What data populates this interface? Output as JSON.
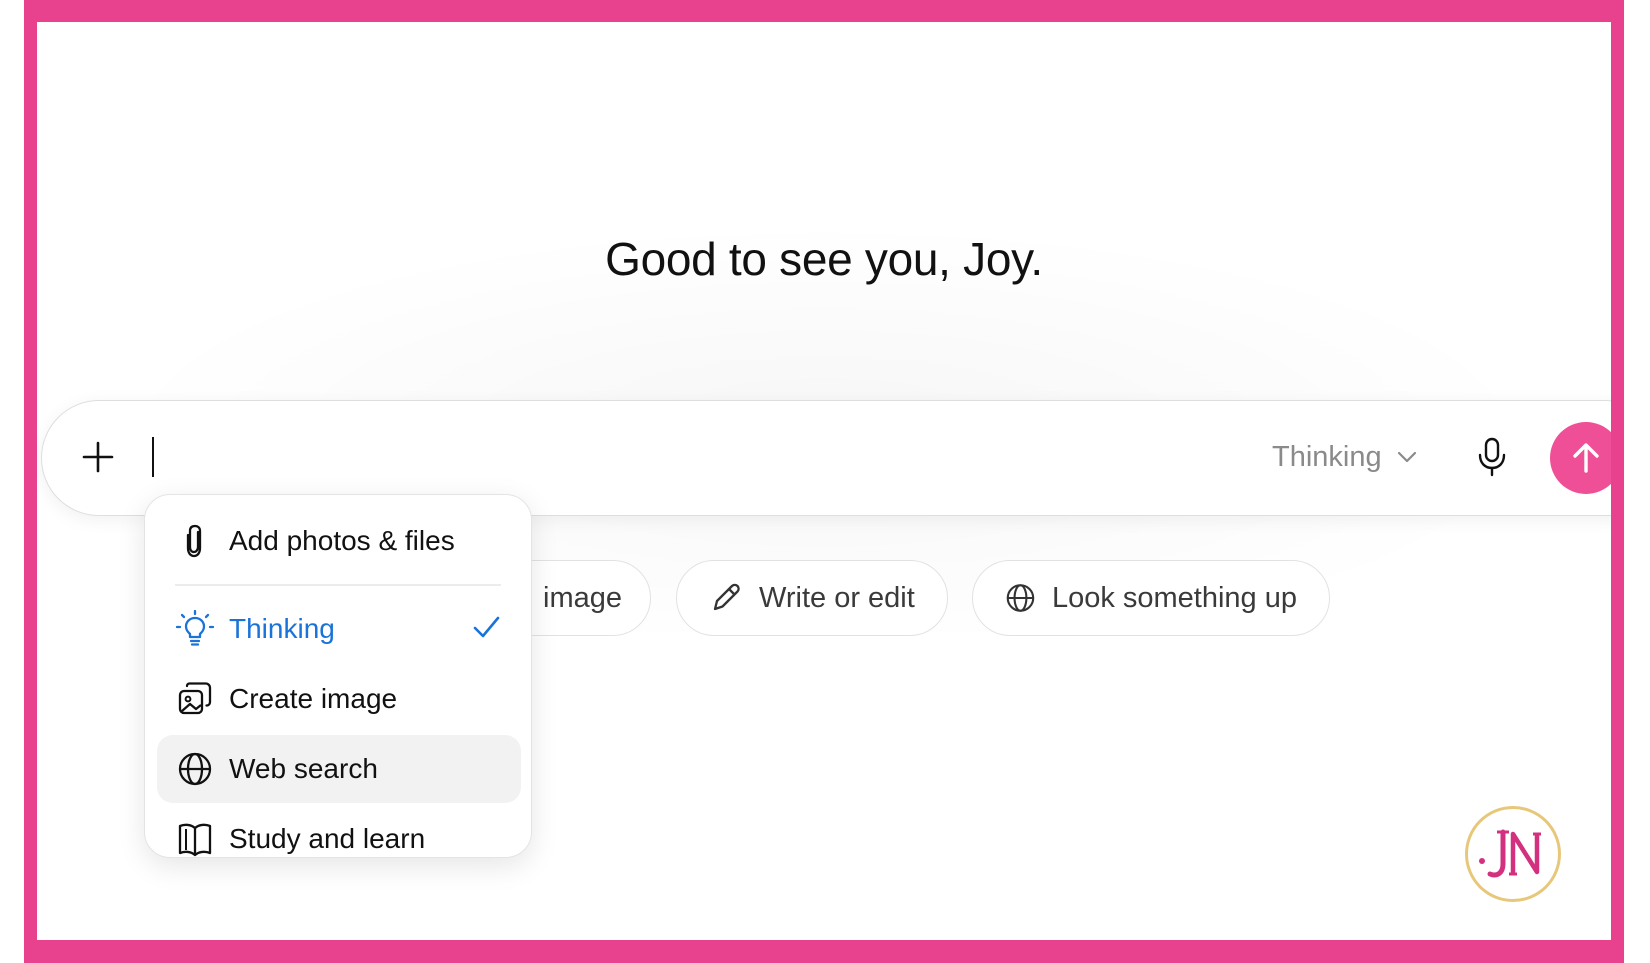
{
  "greeting": "Good to see you, Joy.",
  "composer": {
    "input_value": "",
    "model_label": "Thinking"
  },
  "chips": [
    {
      "label": "image",
      "icon": "image-icon"
    },
    {
      "label": "Write or edit",
      "icon": "pencil-icon"
    },
    {
      "label": "Look something up",
      "icon": "globe-icon"
    }
  ],
  "menu": {
    "items": [
      {
        "label": "Add photos & files",
        "icon": "paperclip-icon"
      },
      {
        "label": "Thinking",
        "icon": "lightbulb-icon",
        "selected": true
      },
      {
        "label": "Create image",
        "icon": "image-stack-icon"
      },
      {
        "label": "Web search",
        "icon": "globe-icon",
        "hovered": true
      },
      {
        "label": "Study and learn",
        "icon": "book-icon"
      }
    ]
  },
  "colors": {
    "frame": "#e8418d",
    "send_button": "#ef4f96",
    "selected_item": "#1a73d9",
    "logo_ring": "#e7c77a"
  },
  "logo": {
    "icon": "jn-monogram-logo"
  }
}
